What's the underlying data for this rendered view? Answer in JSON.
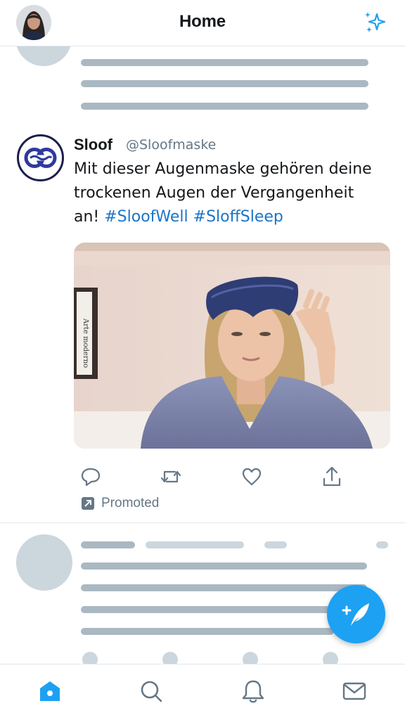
{
  "header": {
    "title": "Home",
    "avatar_icon": "profile-avatar",
    "action_icon": "sparkle-icon"
  },
  "tweet": {
    "author_name": "Sloof",
    "author_handle": "@Sloofmaske",
    "text_lines": [
      "Mit dieser Augenmaske gehören deine",
      "trockenen Augen der Vergangenheit"
    ],
    "text_last_prefix": "an! ",
    "hashtags": [
      "#SloofWell",
      "#SloffSleep"
    ],
    "image_book_text": "Arte moderno",
    "actions": [
      "reply-icon",
      "retweet-icon",
      "like-icon",
      "share-icon"
    ],
    "promoted_label": "Promoted"
  },
  "bottom_nav": [
    "home-icon",
    "search-icon",
    "notifications-icon",
    "messages-icon"
  ],
  "colors": {
    "accent": "#1da1f2",
    "link": "#1b74c8",
    "skeleton_dark": "#aab8c2",
    "skeleton_light": "#ccd6dd",
    "secondary_text": "#657786"
  }
}
